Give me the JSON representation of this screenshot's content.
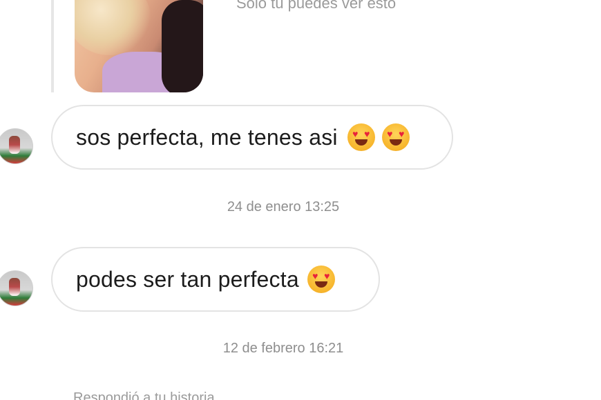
{
  "story": {
    "private_note": "Solo tú puedes ver esto"
  },
  "messages": [
    {
      "text": "sos perfecta, me tenes asi",
      "emoji": "heart-eyes-emoji x2"
    },
    {
      "text": "podes ser tan perfecta",
      "emoji": "heart-eyes-emoji"
    }
  ],
  "timestamps": [
    "24 de enero 13:25",
    "12 de febrero 16:21"
  ],
  "footer": {
    "reply_label": "Respondió a tu historia"
  },
  "colors": {
    "bubble_border": "#e3e3e3",
    "muted_text": "#8e8e8e",
    "background": "#ffffff"
  }
}
